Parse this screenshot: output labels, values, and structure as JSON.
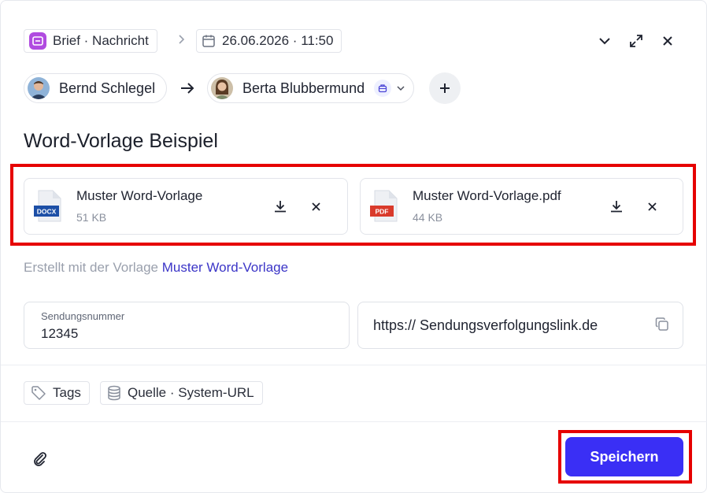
{
  "header": {
    "type_label": "Brief · Nachricht",
    "date_label": "26.06.2026 · 11:50"
  },
  "people": {
    "from_name": "Bernd Schlegel",
    "to_name": "Berta Blubbermund"
  },
  "title": "Word-Vorlage Beispiel",
  "files": [
    {
      "name": "Muster Word-Vorlage",
      "size": "51 KB",
      "badge": "DOCX",
      "badge_color": "#1d4fa6"
    },
    {
      "name": "Muster Word-Vorlage.pdf",
      "size": "44 KB",
      "badge": "PDF",
      "badge_color": "#d93a2b"
    }
  ],
  "created": {
    "prefix": "Erstellt mit der Vorlage ",
    "template_link": "Muster Word-Vorlage"
  },
  "fields": {
    "tracking_number_label": "Sendungsnummer",
    "tracking_number_value": "12345",
    "tracking_link_value": "https:// Sendungsverfolgungslink.de"
  },
  "meta": {
    "tags_label": "Tags",
    "source_label": "Quelle · System-URL"
  },
  "footer": {
    "save_label": "Speichern"
  },
  "colors": {
    "accent": "#3a2ff5",
    "link": "#3b35c7",
    "highlight_frame": "#e60000",
    "type_icon": "#b04be0"
  },
  "icons": [
    "envelope-icon",
    "calendar-icon",
    "chevron-down-icon",
    "expand-icon",
    "close-icon",
    "arrow-right-icon",
    "briefcase-icon",
    "plus-icon",
    "docx-file-icon",
    "pdf-file-icon",
    "download-icon",
    "copy-icon",
    "tag-icon",
    "database-icon",
    "paperclip-icon"
  ]
}
